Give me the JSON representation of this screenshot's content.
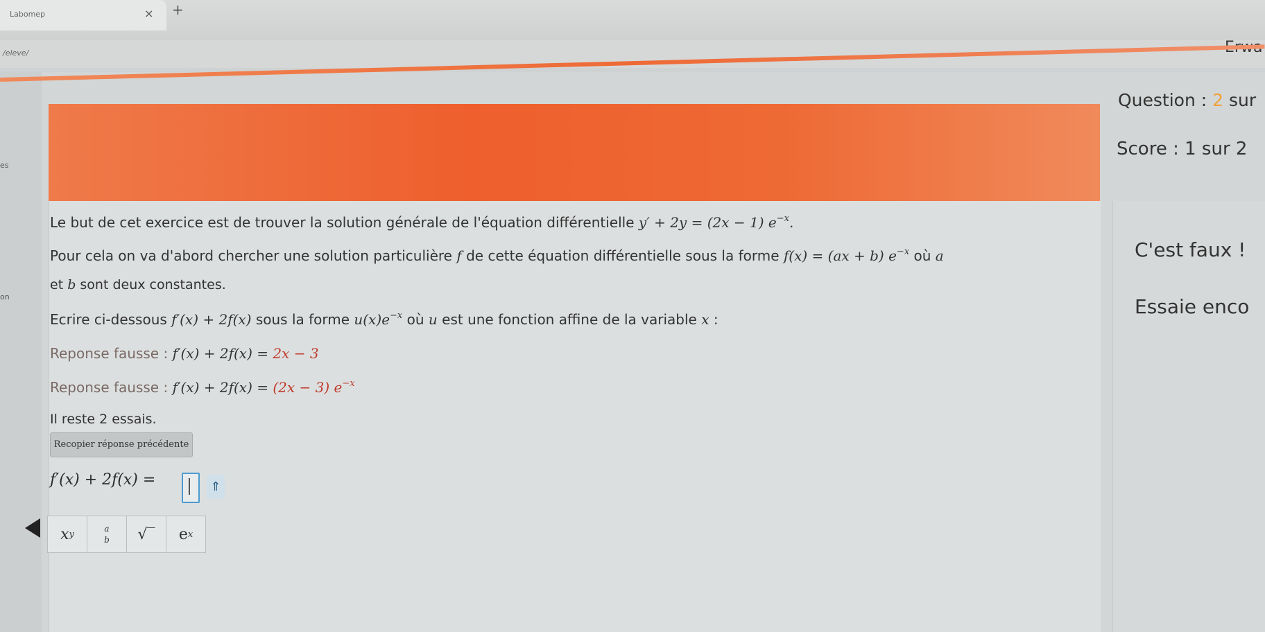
{
  "browser": {
    "tab_title": "Labomep",
    "tab_close": "×",
    "tab_new": "+",
    "url": "/eleve/",
    "user": "Erwa"
  },
  "left": {
    "mark1": "es",
    "mark2": "on"
  },
  "header": {
    "question_prefix": "Question :",
    "question_num": "2",
    "question_suffix": "sur",
    "score": "Score : 1 sur 2"
  },
  "exercise": {
    "intro": "Le but de cet exercice est de trouver la solution générale de l'équation différentielle",
    "equation": "y′ + 2y = (2x − 1) e",
    "equation_exp": "−x",
    "line2_a": "Pour cela on va d'abord chercher une solution particulière",
    "line2_f": "f",
    "line2_b": "de cette équation différentielle sous la forme",
    "line2_math": "f(x) = (ax + b) e",
    "line2_exp": "−x",
    "line2_c": "où",
    "line2_a_var": "a",
    "line3_b_var": "b",
    "line3": "sont deux constantes.",
    "instruction_a": "Ecrire ci-dessous",
    "instruction_math": "f′(x) + 2f(x)",
    "instruction_b": "sous la forme",
    "instruction_math2": "u(x)e",
    "instruction_exp": "−x",
    "instruction_c": "où",
    "instruction_u": "u",
    "instruction_d": "est une fonction affine de la variable",
    "instruction_x": "x",
    "instruction_e": ":"
  },
  "attempts": [
    {
      "label": "Reponse fausse :",
      "lhs": "f′(x) + 2f(x) =",
      "rhs": "2x − 3",
      "exp": ""
    },
    {
      "label": "Reponse fausse :",
      "lhs": "f′(x) + 2f(x) =",
      "rhs": "(2x − 3) e",
      "exp": "−x"
    }
  ],
  "remaining": "Il reste 2 essais.",
  "copy_button": "Recopier réponse précédente",
  "answer": {
    "lhs": "f′(x) + 2f(x) =",
    "expand": "⇑"
  },
  "toolbar": {
    "power_base": "x",
    "power_exp": "y",
    "frac_num": "a",
    "frac_den": "b",
    "sqrt": "√‾",
    "exp_base": "e",
    "exp_exp": "x"
  },
  "feedback": {
    "line1": "C'est faux !",
    "line2": "Essaie enco"
  },
  "colors": {
    "banner": "#ee5f2d",
    "input_border": "#4a9bd0",
    "wrong_answer": "#c0392b",
    "question_number": "#f0a23a"
  }
}
